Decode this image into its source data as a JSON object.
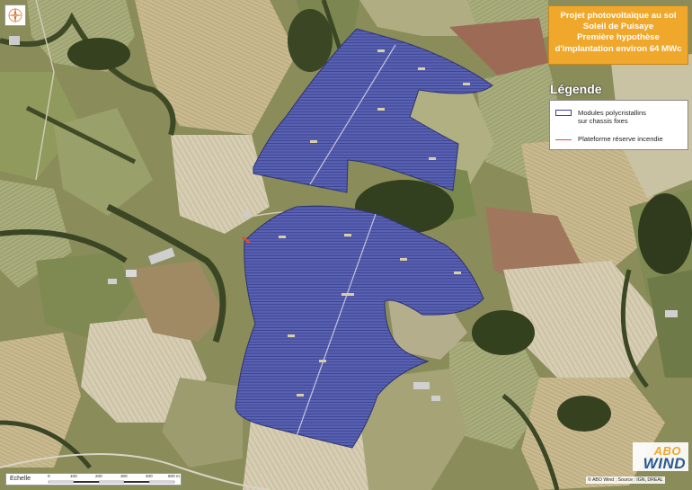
{
  "title": {
    "line1": "Projet photovoltaïque au sol",
    "line2": "Soleil de Puisaye",
    "line3": "Première hypothèse",
    "line4": "d'implantation environ 64 MWc"
  },
  "legend": {
    "heading": "Légende",
    "items": [
      {
        "label_line1": "Modules polycristallins",
        "label_line2": "sur chassis fixes",
        "color": "#3b3f9a"
      },
      {
        "label_line1": "Plateforme réserve incendie",
        "color": "#e84a2a"
      }
    ]
  },
  "scale": {
    "label": "Echelle",
    "ticks": [
      "0",
      "100",
      "200",
      "300",
      "400",
      "500 m"
    ]
  },
  "credit": "© ABO Wind ; Source : IGN, DREAL",
  "logo": {
    "top": "ABO",
    "bottom": "WIND"
  },
  "colors": {
    "module_fill": "#4b52a8",
    "title_bg": "#f0a82c",
    "logo_orange": "#f0a82c",
    "logo_blue": "#2b5a8f"
  }
}
